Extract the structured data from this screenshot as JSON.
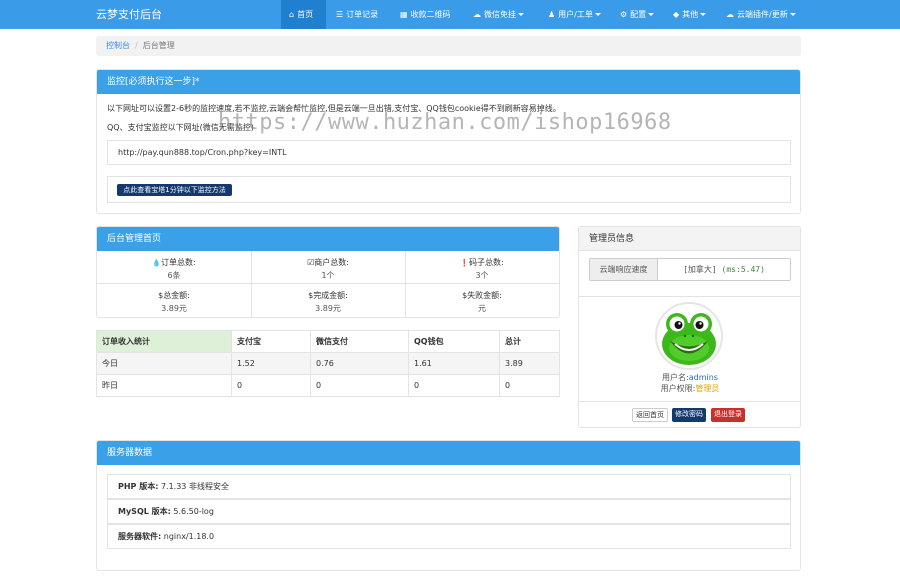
{
  "nav": {
    "brand": "云梦支付后台",
    "items": [
      {
        "label": "首页",
        "icon": "home-icon",
        "glyph": "⌂"
      },
      {
        "label": "订单记录",
        "icon": "list-icon",
        "glyph": "☰"
      },
      {
        "label": "收款二维码",
        "icon": "qrcode-icon",
        "glyph": "▦"
      },
      {
        "label": "微信免挂",
        "icon": "wechat-icon",
        "glyph": "☁"
      },
      {
        "label": "用户/工单",
        "icon": "user-icon",
        "glyph": "♟"
      },
      {
        "label": "配置",
        "icon": "gear-icon",
        "glyph": "⚙"
      },
      {
        "label": "其他",
        "icon": "cube-icon",
        "glyph": "◆"
      },
      {
        "label": "云端插件/更新",
        "icon": "cloud-icon",
        "glyph": "☁"
      }
    ]
  },
  "breadcrumb": {
    "home": "控制台",
    "sep": "/",
    "current": "后台管理"
  },
  "monitor": {
    "title": "监控[必须执行这一步]*",
    "line1": "以下网址可以设置2-6秒的监控速度,若不监控,云端会帮忙监控,但是云端一旦出错,支付宝、QQ钱包cookie得不到刷新容易掉线。",
    "line2": "QQ、支付宝监控以下网址(微信无需监控)",
    "url": "http://pay.qun888.top/Cron.php?key=INTL",
    "button": "点此查看宝塔1分钟以下监控方法"
  },
  "dashboard": {
    "title": "后台管理首页",
    "stats": [
      {
        "icon": "drop-icon",
        "glyph": "💧",
        "label": "订单总数:",
        "value": "6条"
      },
      {
        "icon": "check-icon",
        "glyph": "☑",
        "label": "商户总数:",
        "value": "1个"
      },
      {
        "icon": "info-icon",
        "glyph": "❗",
        "label": "码子总数:",
        "value": "3个"
      },
      {
        "icon": "dollar-icon",
        "glyph": "$",
        "label": "总金额:",
        "value": "3.89元"
      },
      {
        "icon": "dollar-icon",
        "glyph": "$",
        "label": "完成金额:",
        "value": "3.89元"
      },
      {
        "icon": "dollar-icon",
        "glyph": "$",
        "label": "失败金额:",
        "value": "元"
      }
    ]
  },
  "income": {
    "headers": [
      "订单收入统计",
      "支付宝",
      "微信支付",
      "QQ钱包",
      "总计"
    ],
    "rows": [
      [
        "今日",
        "1.52",
        "0.76",
        "1.61",
        "3.89"
      ],
      [
        "昨日",
        "0",
        "0",
        "0",
        "0"
      ]
    ]
  },
  "admin": {
    "title": "管理员信息",
    "speed_label": "云端响应速度",
    "speed_name": "[加拿大]",
    "speed_ms": "(ms:5.47)",
    "username_label": "用户名:",
    "username": "admins",
    "role_label": "用户权限:",
    "role": "管理员",
    "buttons": {
      "home": "返回首页",
      "password": "修改密码",
      "logout": "退出登录"
    }
  },
  "server": {
    "title": "服务器数据",
    "rows": [
      {
        "label": "PHP 版本:",
        "value": "7.1.33 非线程安全"
      },
      {
        "label": "MySQL 版本:",
        "value": "5.6.50-log"
      },
      {
        "label": "服务器软件:",
        "value": "nginx/1.18.0"
      }
    ]
  },
  "watermark": "https://www.huzhan.com/ishop16968"
}
